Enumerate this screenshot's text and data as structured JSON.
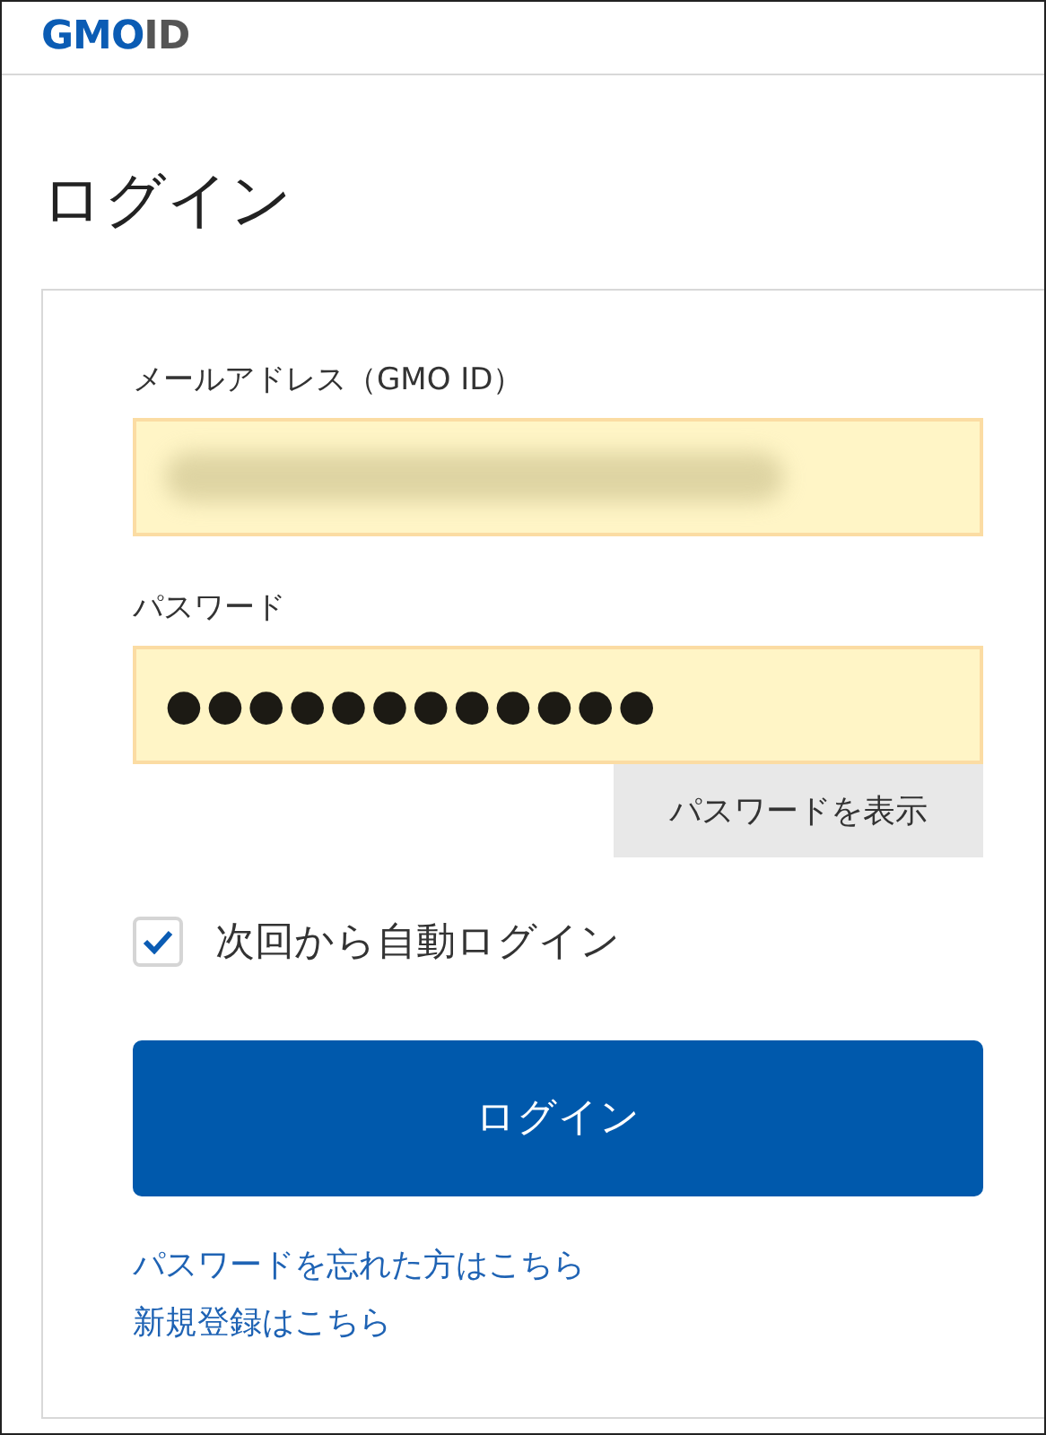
{
  "logo": {
    "parts": [
      {
        "text": "GMO",
        "color": "#0b5cb4"
      },
      {
        "text": "ID",
        "color": "#555555"
      }
    ]
  },
  "title": "ログイン",
  "form": {
    "email": {
      "label": "メールアドレス（GMO ID）",
      "obscured": true
    },
    "password": {
      "label": "パスワード",
      "value": "●●●●●●●●●●●●"
    },
    "show_password_button": "パスワードを表示",
    "auto_login": {
      "label": "次回から自動ログイン",
      "checked": true
    },
    "submit_button": "ログイン",
    "links": [
      "パスワードを忘れた方はこちら",
      "新規登録はこちら"
    ]
  }
}
